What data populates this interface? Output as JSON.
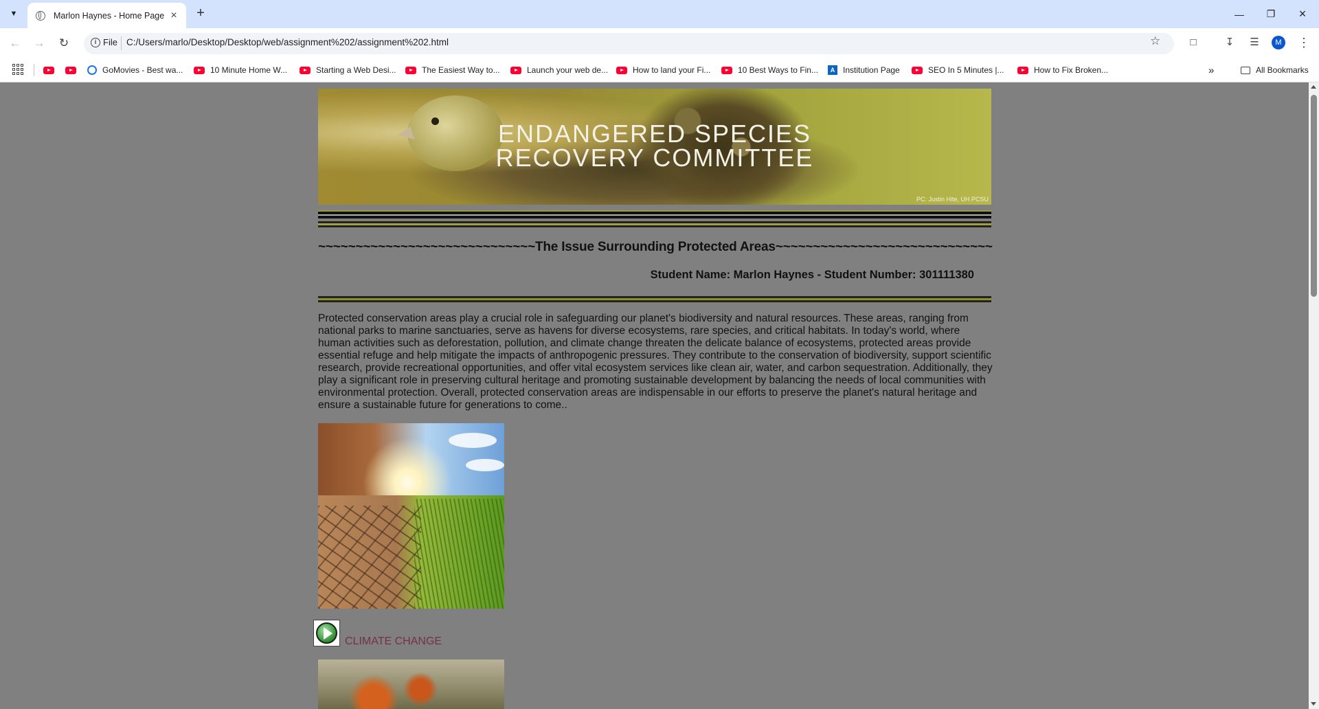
{
  "browser": {
    "tab_title": "Marlon Haynes - Home Page",
    "address_scheme": "File",
    "url": "C:/Users/marlo/Desktop/Desktop/web/assignment%202/assignment%202.html",
    "avatar_letter": "M"
  },
  "bookmarks": {
    "items": [
      {
        "label": "",
        "icon": "youtube-icon"
      },
      {
        "label": "",
        "icon": "youtube-icon"
      },
      {
        "label": "GoMovies - Best wa...",
        "icon": "gomovies-icon"
      },
      {
        "label": "10 Minute Home W...",
        "icon": "youtube-icon"
      },
      {
        "label": "Starting a Web Desi...",
        "icon": "youtube-icon"
      },
      {
        "label": "The Easiest Way to...",
        "icon": "youtube-icon"
      },
      {
        "label": "Launch your web de...",
        "icon": "youtube-icon"
      },
      {
        "label": "How to land your Fi...",
        "icon": "youtube-icon"
      },
      {
        "label": "10 Best Ways to Fin...",
        "icon": "youtube-icon"
      },
      {
        "label": "Institution Page",
        "icon": "institution-icon"
      },
      {
        "label": "SEO In 5 Minutes |...",
        "icon": "youtube-icon"
      },
      {
        "label": "How to Fix Broken...",
        "icon": "youtube-icon"
      }
    ],
    "all_bookmarks": "All Bookmarks"
  },
  "page": {
    "banner_title_line1": "ENDANGERED SPECIES",
    "banner_title_line2": "RECOVERY COMMITTEE",
    "banner_credit": "PC: Justin Hite, UH PCSU",
    "heading": "~~~~~~~~~~~~~~~~~~~~~~~~~~~~~The Issue Surrounding Protected Areas~~~~~~~~~~~~~~~~~~~~~~~~~~~~~",
    "student_line": "Student Name: Marlon Haynes - Student Number: 301111380",
    "paragraph": "Protected conservation areas play a crucial role in safeguarding our planet's biodiversity and natural resources. These areas, ranging from national parks to marine sanctuaries, serve as havens for diverse ecosystems, rare species, and critical habitats. In today's world, where human activities such as deforestation, pollution, and climate change threaten the delicate balance of ecosystems, protected areas provide essential refuge and help mitigate the impacts of anthropogenic pressures. They contribute to the conservation of biodiversity, support scientific research, provide recreational opportunities, and offer vital ecosystem services like clean air, water, and carbon sequestration. Additionally, they play a significant role in preserving cultural heritage and promoting sustainable development by balancing the needs of local communities with environmental protection. Overall, protected conservation areas are indispensable in our efforts to preserve the planet's natural heritage and ensure a sustainable future for generations to come..",
    "link_label": "CLIMATE CHANGE",
    "link_color": "#74304a",
    "background_color": "#808080"
  }
}
